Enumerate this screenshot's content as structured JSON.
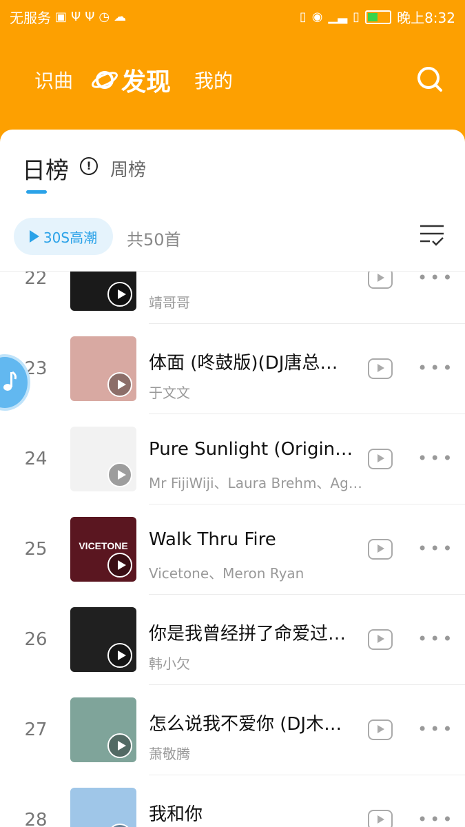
{
  "status_bar": {
    "carrier": "无服务",
    "time": "晚上8:32"
  },
  "nav": {
    "recognize": "识曲",
    "discover": "发现",
    "mine": "我的"
  },
  "board": {
    "daily": "日榜",
    "weekly": "周榜",
    "info_icon_glyph": "!"
  },
  "controls": {
    "play_label": "30S高潮",
    "count": "共50首"
  },
  "colors": {
    "header": "#FDA001",
    "accent": "#2AA2E8"
  },
  "songs": [
    {
      "rank": "22",
      "title": "",
      "artist": "靖哥哥",
      "cover_color": "#1a1a1a"
    },
    {
      "rank": "23",
      "title": "体面 (咚鼓版)(DJ唐总、…",
      "artist": "于文文",
      "cover_color": "#d8a9a2"
    },
    {
      "rank": "24",
      "title": "Pure Sunlight (Original…",
      "artist": "Mr FijiWiji、Laura Brehm、Ag…",
      "cover_color": "#f2f2f2"
    },
    {
      "rank": "25",
      "title": "Walk Thru Fire",
      "artist": "Vicetone、Meron Ryan",
      "cover_color": "#5a1620"
    },
    {
      "rank": "26",
      "title": "你是我曾经拼了命爱过…",
      "artist": "韩小欠",
      "cover_color": "#202020"
    },
    {
      "rank": "27",
      "title": "怎么说我不爱你 (DJ木…",
      "artist": "萧敬腾",
      "cover_color": "#7fa49a"
    },
    {
      "rank": "28",
      "title": "我和你",
      "artist": "",
      "cover_color": "#9fc6e8"
    }
  ],
  "cover_text": {
    "vicetone": "VICETONE"
  }
}
